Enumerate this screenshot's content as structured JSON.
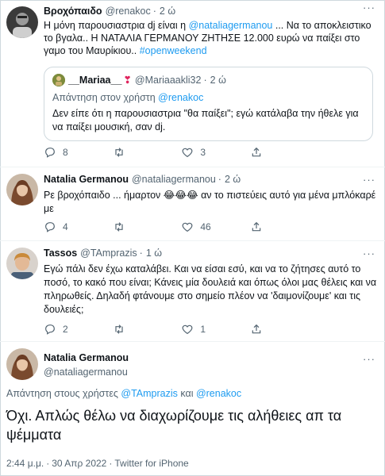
{
  "tweets": [
    {
      "name": "Βροχόπαιδο",
      "handle": "@renakoc",
      "time": "2 ώ",
      "text_pre": "Η μόνη παρουσιαστρια dj είναι η ",
      "mention": "@nataliagermanou",
      "text_mid": " ... Να το αποκλειστικο το βγαλα.. Η ΝΑΤΑΛΙΑ ΓΕΡΜΑΝΟΥ ΖΗΤΗΣΕ 12.000 ευρώ να παίξει στο γαμο του Μαυρίκιου.. ",
      "hashtag": "#openweekend",
      "quote": {
        "name": "__Mariaa__",
        "handle": "@Mariaaakli32",
        "time": "2 ώ",
        "reply_prefix": "Απάντηση στον χρήστη ",
        "reply_to": "@renakoc",
        "text": "Δεν είπε ότι η παρουσιαστρια \"θα παίξει\"; εγώ κατάλαβα την ήθελε για να παίξει μουσική, σαν dj."
      },
      "replies": "8",
      "retweets": "",
      "likes": "3"
    },
    {
      "name": "Natalia Germanou",
      "handle": "@nataliagermanou",
      "time": "2 ώ",
      "text_pre": "Ρε βροχόπαιδο ... ήμαρτον ",
      "emoji": "😂😂😂",
      "text_post": " αν το πιστεύεις αυτό για μένα μπλόκαρέ με",
      "replies": "4",
      "retweets": "",
      "likes": "46"
    },
    {
      "name": "Tassos",
      "handle": "@TAmprazis",
      "time": "1 ώ",
      "text": "Εγώ πάλι δεν έχω καταλάβει. Και να είσαι εσύ, και να το ζήτησες αυτό το ποσό, το κακό που είναι; Κάνεις μία δουλειά και όπως όλοι μας θέλεις και να πληρωθείς. Δηλαδή φτάνουμε στο σημείο πλέον να 'δαιμονίζουμε' και τις δουλειές;",
      "replies": "2",
      "retweets": "",
      "likes": "1"
    }
  ],
  "main": {
    "name": "Natalia Germanou",
    "handle": "@nataliagermanou",
    "replying_prefix": "Απάντηση στους χρήστες ",
    "replying_user1": "@TAmprazis",
    "replying_and": " και ",
    "replying_user2": "@renakoc",
    "text": "Όχι. Απλώς θέλω να διαχωρίζουμε τις αλήθειες απ τα ψέμματα",
    "time": "2:44 μ.μ.",
    "date": "30 Απρ 2022",
    "client": "Twitter for iPhone"
  },
  "separator": "·",
  "more": "···",
  "colors": {
    "link": "#1d9bf0",
    "secondary": "#536471",
    "border": "#cfd9de"
  }
}
